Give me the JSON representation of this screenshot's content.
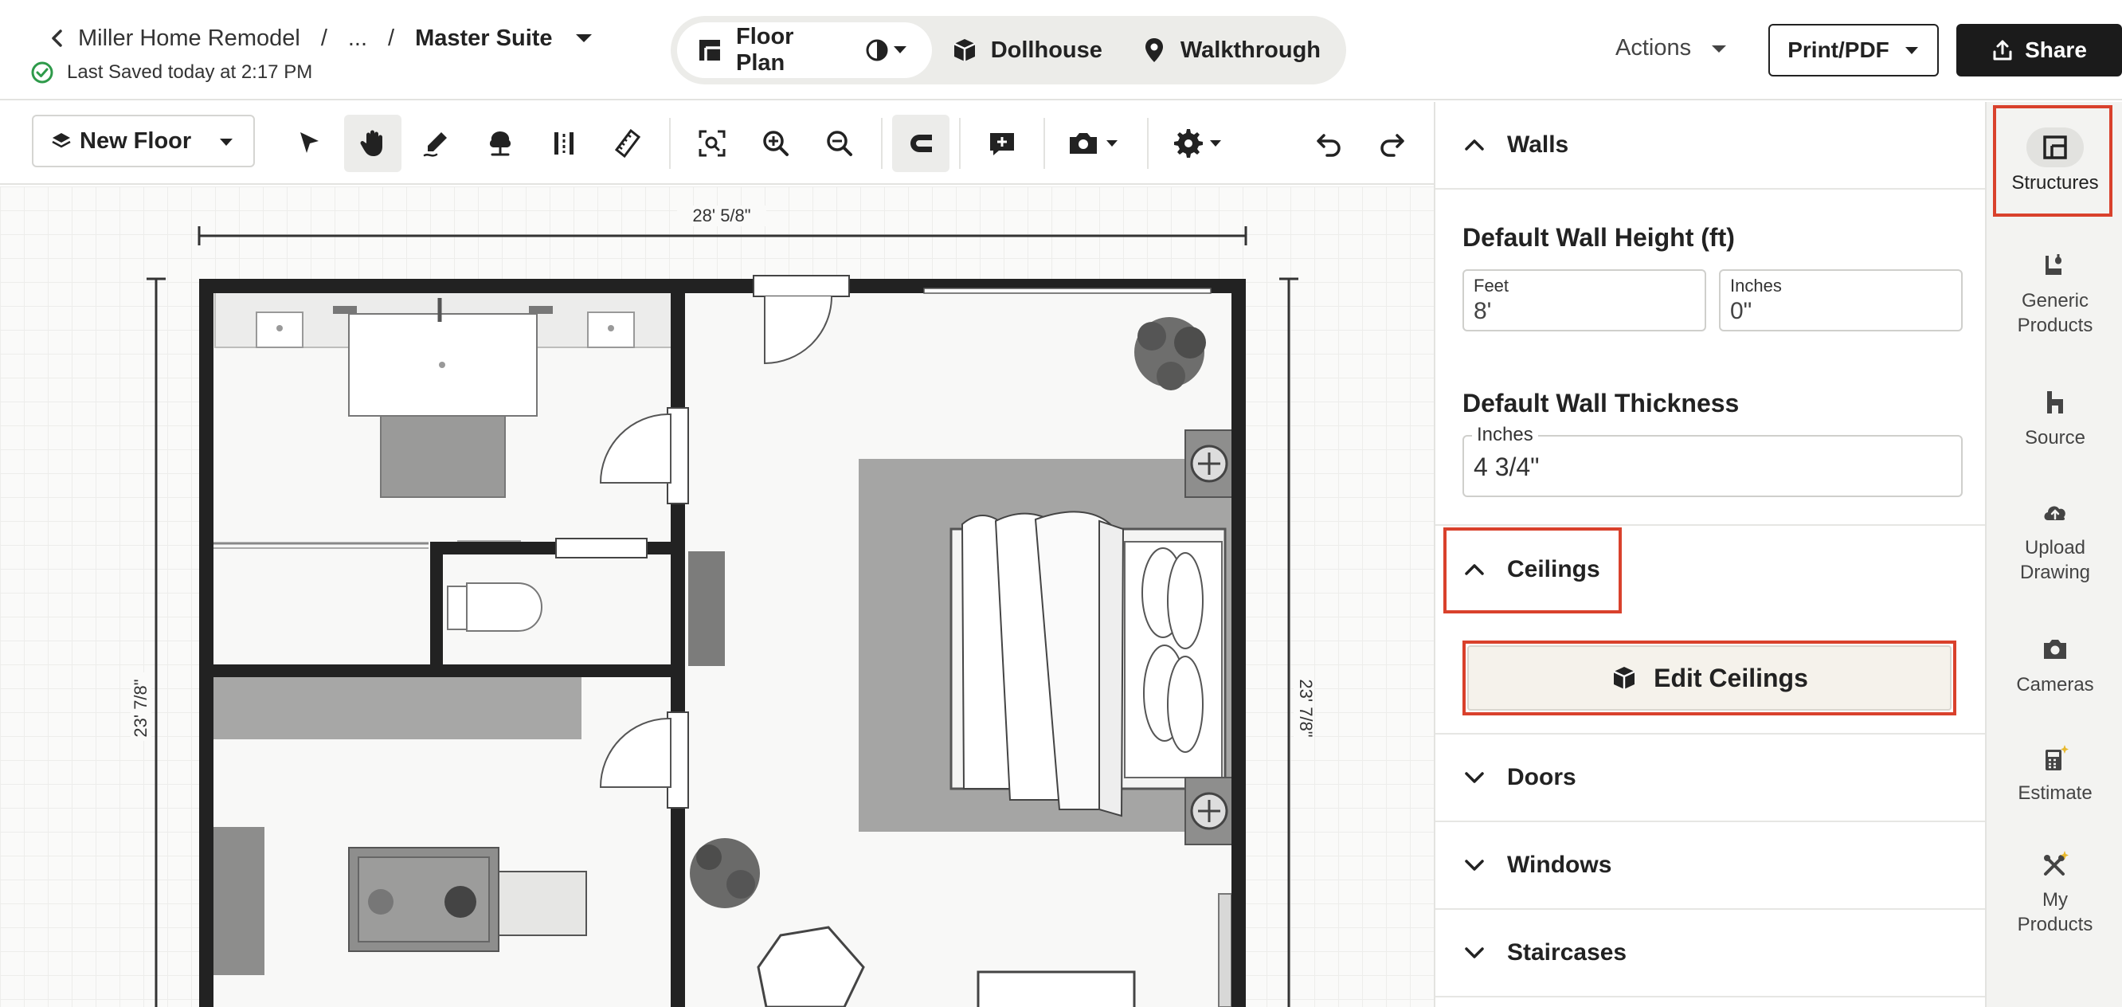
{
  "breadcrumb": {
    "project": "Miller Home Remodel",
    "sep1": "/",
    "ellipsis": "...",
    "sep2": "/",
    "current": "Master Suite"
  },
  "save_status": "Last Saved today at 2:17 PM",
  "view_modes": [
    {
      "label": "Floor Plan",
      "icon": "floorplan-icon",
      "active": true
    },
    {
      "label": "Dollhouse",
      "icon": "cube-icon",
      "active": false
    },
    {
      "label": "Walkthrough",
      "icon": "map-pin-icon",
      "active": false
    }
  ],
  "header_actions": {
    "actions_label": "Actions",
    "print_label": "Print/PDF",
    "share_label": "Share"
  },
  "toolbar": {
    "floor_select": "New Floor",
    "tools": [
      "select-arrow-icon",
      "pan-hand-icon",
      "draw-wall-icon",
      "tree-icon",
      "dimension-icon",
      "ruler-icon",
      "fit-view-icon",
      "zoom-in-icon",
      "zoom-out-icon",
      "magnet-snap-icon",
      "add-comment-icon",
      "camera-icon",
      "settings-icon",
      "undo-icon",
      "redo-icon"
    ],
    "active_tool": "pan-hand-icon"
  },
  "canvas": {
    "dim_top": "28' 5/8\"",
    "dim_left": "23' 7/8\"",
    "dim_right": "23' 7/8\""
  },
  "panel": {
    "walls_header": "Walls",
    "wall_height_title": "Default Wall Height (ft)",
    "feet_label": "Feet",
    "feet_value": "8'",
    "inches_label": "Inches",
    "inches_value": "0\"",
    "wall_thickness_title": "Default Wall Thickness",
    "thickness_label": "Inches",
    "thickness_value": "4 3/4\"",
    "ceilings_header": "Ceilings",
    "edit_ceilings_label": "Edit Ceilings",
    "doors_header": "Doors",
    "windows_header": "Windows",
    "staircases_header": "Staircases"
  },
  "rail": [
    {
      "label": "Structures",
      "icon": "structures-icon",
      "active": true
    },
    {
      "label": "Generic Products",
      "icon": "generic-products-icon",
      "active": false
    },
    {
      "label": "Source",
      "icon": "source-icon",
      "active": false
    },
    {
      "label": "Upload Drawing",
      "icon": "upload-cloud-icon",
      "active": false
    },
    {
      "label": "Cameras",
      "icon": "camera-icon",
      "active": false
    },
    {
      "label": "Estimate",
      "icon": "calculator-icon",
      "active": false
    },
    {
      "label": "My Products",
      "icon": "my-products-icon",
      "active": false
    }
  ],
  "colors": {
    "highlight": "#d9412c",
    "primary_dark": "#1b1b1b",
    "success": "#2e9a4a",
    "sparkle": "#e8b92e"
  }
}
